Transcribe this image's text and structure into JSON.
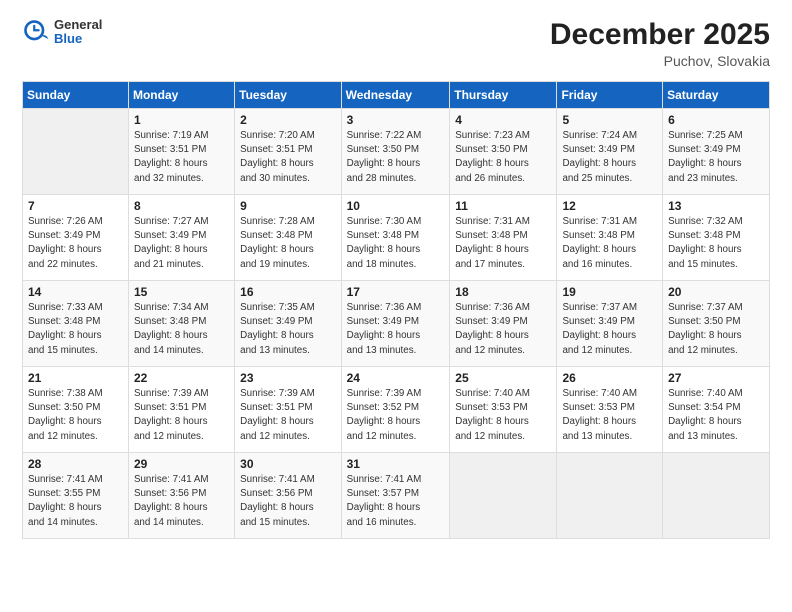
{
  "header": {
    "logo_general": "General",
    "logo_blue": "Blue",
    "month_title": "December 2025",
    "location": "Puchov, Slovakia"
  },
  "days_of_week": [
    "Sunday",
    "Monday",
    "Tuesday",
    "Wednesday",
    "Thursday",
    "Friday",
    "Saturday"
  ],
  "weeks": [
    [
      {
        "day": "",
        "sunrise": "",
        "sunset": "",
        "daylight": ""
      },
      {
        "day": "1",
        "sunrise": "Sunrise: 7:19 AM",
        "sunset": "Sunset: 3:51 PM",
        "daylight": "Daylight: 8 hours and 32 minutes."
      },
      {
        "day": "2",
        "sunrise": "Sunrise: 7:20 AM",
        "sunset": "Sunset: 3:51 PM",
        "daylight": "Daylight: 8 hours and 30 minutes."
      },
      {
        "day": "3",
        "sunrise": "Sunrise: 7:22 AM",
        "sunset": "Sunset: 3:50 PM",
        "daylight": "Daylight: 8 hours and 28 minutes."
      },
      {
        "day": "4",
        "sunrise": "Sunrise: 7:23 AM",
        "sunset": "Sunset: 3:50 PM",
        "daylight": "Daylight: 8 hours and 26 minutes."
      },
      {
        "day": "5",
        "sunrise": "Sunrise: 7:24 AM",
        "sunset": "Sunset: 3:49 PM",
        "daylight": "Daylight: 8 hours and 25 minutes."
      },
      {
        "day": "6",
        "sunrise": "Sunrise: 7:25 AM",
        "sunset": "Sunset: 3:49 PM",
        "daylight": "Daylight: 8 hours and 23 minutes."
      }
    ],
    [
      {
        "day": "7",
        "sunrise": "Sunrise: 7:26 AM",
        "sunset": "Sunset: 3:49 PM",
        "daylight": "Daylight: 8 hours and 22 minutes."
      },
      {
        "day": "8",
        "sunrise": "Sunrise: 7:27 AM",
        "sunset": "Sunset: 3:49 PM",
        "daylight": "Daylight: 8 hours and 21 minutes."
      },
      {
        "day": "9",
        "sunrise": "Sunrise: 7:28 AM",
        "sunset": "Sunset: 3:48 PM",
        "daylight": "Daylight: 8 hours and 19 minutes."
      },
      {
        "day": "10",
        "sunrise": "Sunrise: 7:30 AM",
        "sunset": "Sunset: 3:48 PM",
        "daylight": "Daylight: 8 hours and 18 minutes."
      },
      {
        "day": "11",
        "sunrise": "Sunrise: 7:31 AM",
        "sunset": "Sunset: 3:48 PM",
        "daylight": "Daylight: 8 hours and 17 minutes."
      },
      {
        "day": "12",
        "sunrise": "Sunrise: 7:31 AM",
        "sunset": "Sunset: 3:48 PM",
        "daylight": "Daylight: 8 hours and 16 minutes."
      },
      {
        "day": "13",
        "sunrise": "Sunrise: 7:32 AM",
        "sunset": "Sunset: 3:48 PM",
        "daylight": "Daylight: 8 hours and 15 minutes."
      }
    ],
    [
      {
        "day": "14",
        "sunrise": "Sunrise: 7:33 AM",
        "sunset": "Sunset: 3:48 PM",
        "daylight": "Daylight: 8 hours and 15 minutes."
      },
      {
        "day": "15",
        "sunrise": "Sunrise: 7:34 AM",
        "sunset": "Sunset: 3:48 PM",
        "daylight": "Daylight: 8 hours and 14 minutes."
      },
      {
        "day": "16",
        "sunrise": "Sunrise: 7:35 AM",
        "sunset": "Sunset: 3:49 PM",
        "daylight": "Daylight: 8 hours and 13 minutes."
      },
      {
        "day": "17",
        "sunrise": "Sunrise: 7:36 AM",
        "sunset": "Sunset: 3:49 PM",
        "daylight": "Daylight: 8 hours and 13 minutes."
      },
      {
        "day": "18",
        "sunrise": "Sunrise: 7:36 AM",
        "sunset": "Sunset: 3:49 PM",
        "daylight": "Daylight: 8 hours and 12 minutes."
      },
      {
        "day": "19",
        "sunrise": "Sunrise: 7:37 AM",
        "sunset": "Sunset: 3:49 PM",
        "daylight": "Daylight: 8 hours and 12 minutes."
      },
      {
        "day": "20",
        "sunrise": "Sunrise: 7:37 AM",
        "sunset": "Sunset: 3:50 PM",
        "daylight": "Daylight: 8 hours and 12 minutes."
      }
    ],
    [
      {
        "day": "21",
        "sunrise": "Sunrise: 7:38 AM",
        "sunset": "Sunset: 3:50 PM",
        "daylight": "Daylight: 8 hours and 12 minutes."
      },
      {
        "day": "22",
        "sunrise": "Sunrise: 7:39 AM",
        "sunset": "Sunset: 3:51 PM",
        "daylight": "Daylight: 8 hours and 12 minutes."
      },
      {
        "day": "23",
        "sunrise": "Sunrise: 7:39 AM",
        "sunset": "Sunset: 3:51 PM",
        "daylight": "Daylight: 8 hours and 12 minutes."
      },
      {
        "day": "24",
        "sunrise": "Sunrise: 7:39 AM",
        "sunset": "Sunset: 3:52 PM",
        "daylight": "Daylight: 8 hours and 12 minutes."
      },
      {
        "day": "25",
        "sunrise": "Sunrise: 7:40 AM",
        "sunset": "Sunset: 3:53 PM",
        "daylight": "Daylight: 8 hours and 12 minutes."
      },
      {
        "day": "26",
        "sunrise": "Sunrise: 7:40 AM",
        "sunset": "Sunset: 3:53 PM",
        "daylight": "Daylight: 8 hours and 13 minutes."
      },
      {
        "day": "27",
        "sunrise": "Sunrise: 7:40 AM",
        "sunset": "Sunset: 3:54 PM",
        "daylight": "Daylight: 8 hours and 13 minutes."
      }
    ],
    [
      {
        "day": "28",
        "sunrise": "Sunrise: 7:41 AM",
        "sunset": "Sunset: 3:55 PM",
        "daylight": "Daylight: 8 hours and 14 minutes."
      },
      {
        "day": "29",
        "sunrise": "Sunrise: 7:41 AM",
        "sunset": "Sunset: 3:56 PM",
        "daylight": "Daylight: 8 hours and 14 minutes."
      },
      {
        "day": "30",
        "sunrise": "Sunrise: 7:41 AM",
        "sunset": "Sunset: 3:56 PM",
        "daylight": "Daylight: 8 hours and 15 minutes."
      },
      {
        "day": "31",
        "sunrise": "Sunrise: 7:41 AM",
        "sunset": "Sunset: 3:57 PM",
        "daylight": "Daylight: 8 hours and 16 minutes."
      },
      {
        "day": "",
        "sunrise": "",
        "sunset": "",
        "daylight": ""
      },
      {
        "day": "",
        "sunrise": "",
        "sunset": "",
        "daylight": ""
      },
      {
        "day": "",
        "sunrise": "",
        "sunset": "",
        "daylight": ""
      }
    ]
  ]
}
